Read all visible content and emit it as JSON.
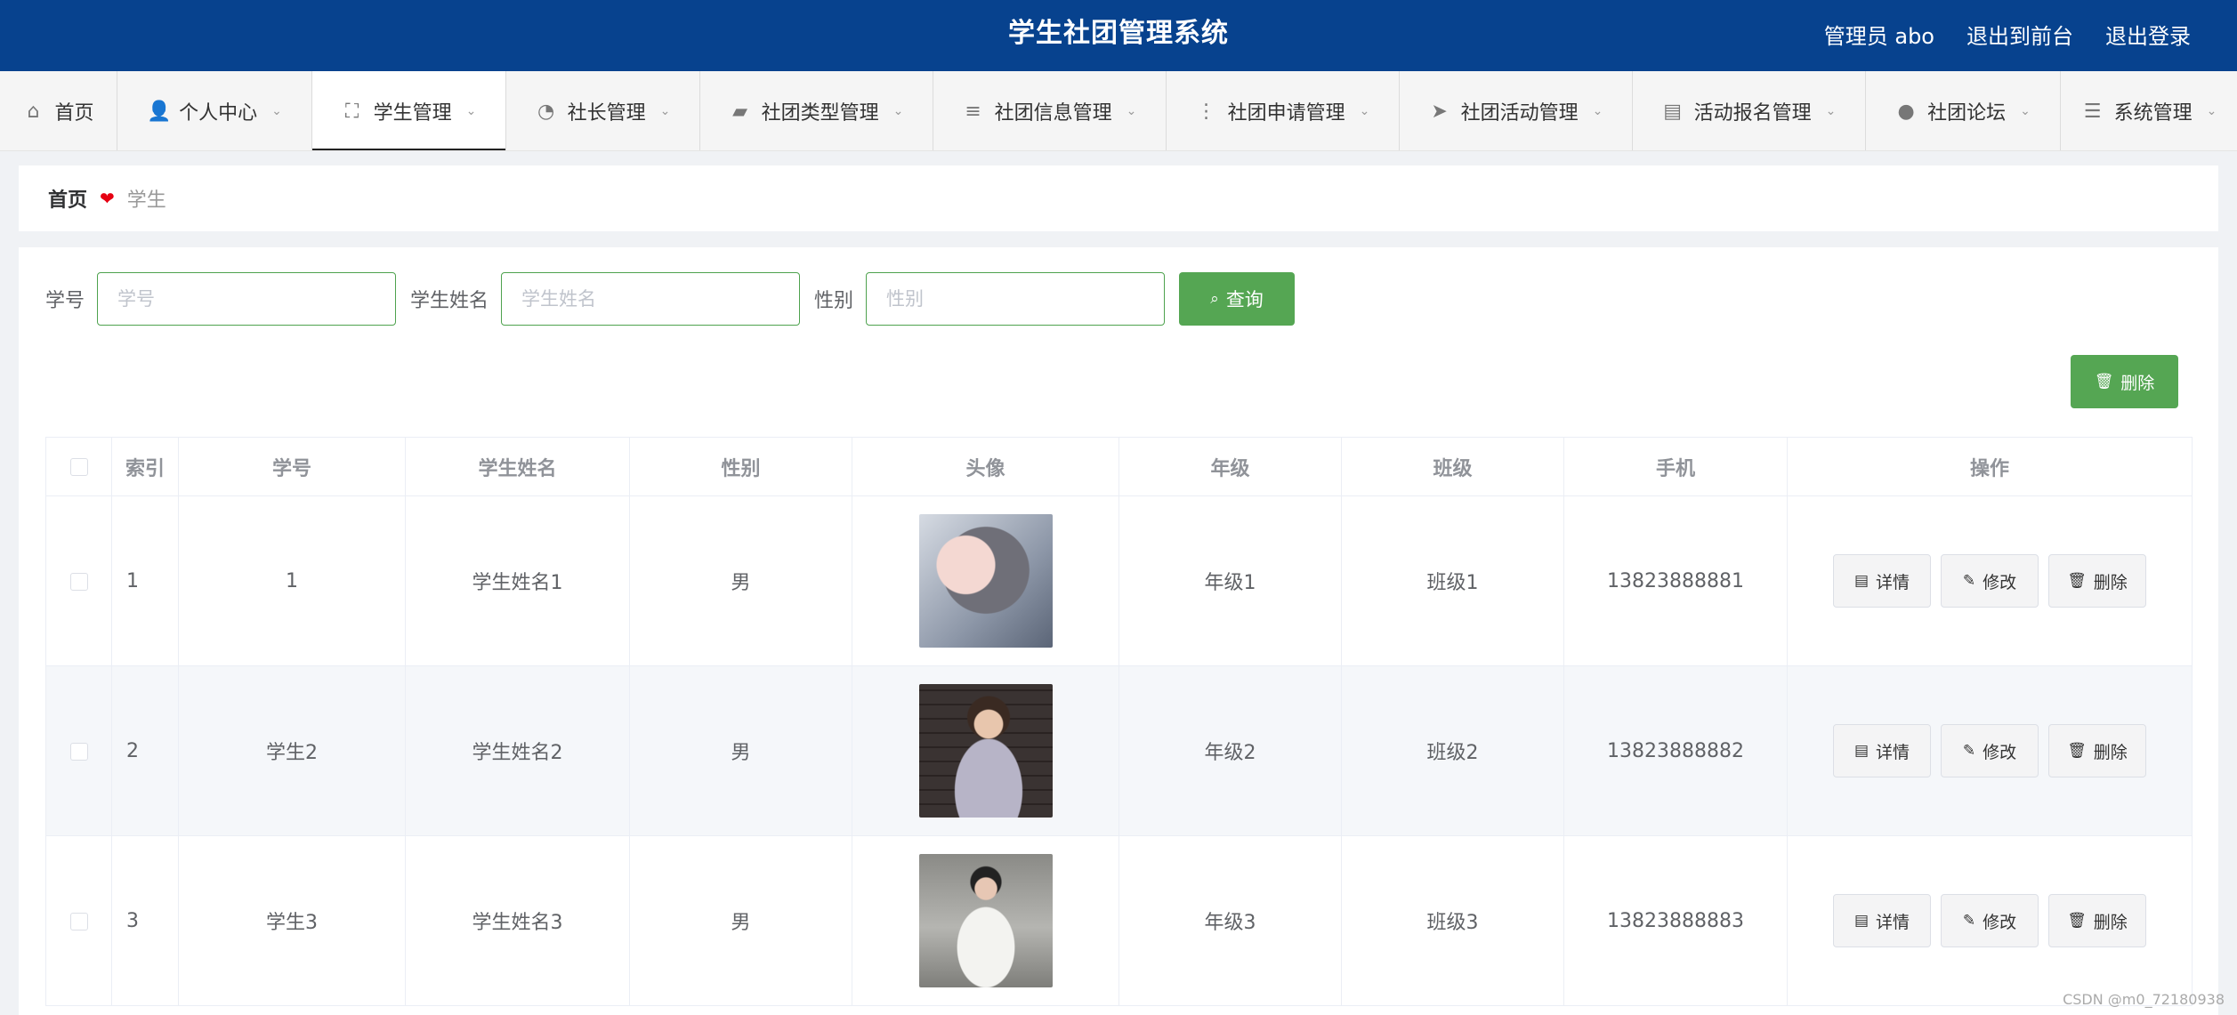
{
  "header": {
    "title": "学生社团管理系统",
    "user": "管理员 abo",
    "to_front": "退出到前台",
    "logout": "退出登录"
  },
  "nav": [
    {
      "label": "首页",
      "icon": "home-icon",
      "glyph": "⌂",
      "dropdown": false,
      "active": false
    },
    {
      "label": "个人中心",
      "icon": "user-icon",
      "glyph": "👤",
      "dropdown": true,
      "active": false
    },
    {
      "label": "学生管理",
      "icon": "fullscreen-icon",
      "glyph": "⛶",
      "dropdown": true,
      "active": true
    },
    {
      "label": "社长管理",
      "icon": "compass-icon",
      "glyph": "◔",
      "dropdown": true,
      "active": false
    },
    {
      "label": "社团类型管理",
      "icon": "wallet-icon",
      "glyph": "▰",
      "dropdown": true,
      "active": false
    },
    {
      "label": "社团信息管理",
      "icon": "list-icon",
      "glyph": "≡",
      "dropdown": true,
      "active": false
    },
    {
      "label": "社团申请管理",
      "icon": "microphone-icon",
      "glyph": "⋮",
      "dropdown": true,
      "active": false
    },
    {
      "label": "社团活动管理",
      "icon": "send-icon",
      "glyph": "➤",
      "dropdown": true,
      "active": false
    },
    {
      "label": "活动报名管理",
      "icon": "clipboard-icon",
      "glyph": "▤",
      "dropdown": true,
      "active": false
    },
    {
      "label": "社团论坛",
      "icon": "bulb-icon",
      "glyph": "●",
      "dropdown": true,
      "active": false
    },
    {
      "label": "系统管理",
      "icon": "menu-icon",
      "glyph": "☰",
      "dropdown": true,
      "active": false
    }
  ],
  "breadcrumb": {
    "home": "首页",
    "current": "学生"
  },
  "search": {
    "student_no_label": "学号",
    "student_no_placeholder": "学号",
    "student_no_value": "",
    "name_label": "学生姓名",
    "name_placeholder": "学生姓名",
    "name_value": "",
    "gender_label": "性别",
    "gender_placeholder": "性别",
    "gender_value": "",
    "query_button": "查询"
  },
  "toolbar": {
    "delete_button": "删除"
  },
  "table": {
    "columns": [
      "索引",
      "学号",
      "学生姓名",
      "性别",
      "头像",
      "年级",
      "班级",
      "手机",
      "操作"
    ],
    "rows": [
      {
        "index": "1",
        "student_no": "1",
        "name": "学生姓名1",
        "gender": "男",
        "avatar": "av1",
        "grade": "年级1",
        "class": "班级1",
        "phone": "13823888881"
      },
      {
        "index": "2",
        "student_no": "学生2",
        "name": "学生姓名2",
        "gender": "男",
        "avatar": "av2",
        "grade": "年级2",
        "class": "班级2",
        "phone": "13823888882"
      },
      {
        "index": "3",
        "student_no": "学生3",
        "name": "学生姓名3",
        "gender": "男",
        "avatar": "av3",
        "grade": "年级3",
        "class": "班级3",
        "phone": "13823888883"
      }
    ],
    "actions": {
      "detail": "详情",
      "edit": "修改",
      "delete": "删除"
    }
  },
  "watermark": "CSDN @m0_72180938",
  "colors": {
    "header_bg": "#07428e",
    "primary_green": "#55a653",
    "heart_red": "#e60012"
  }
}
